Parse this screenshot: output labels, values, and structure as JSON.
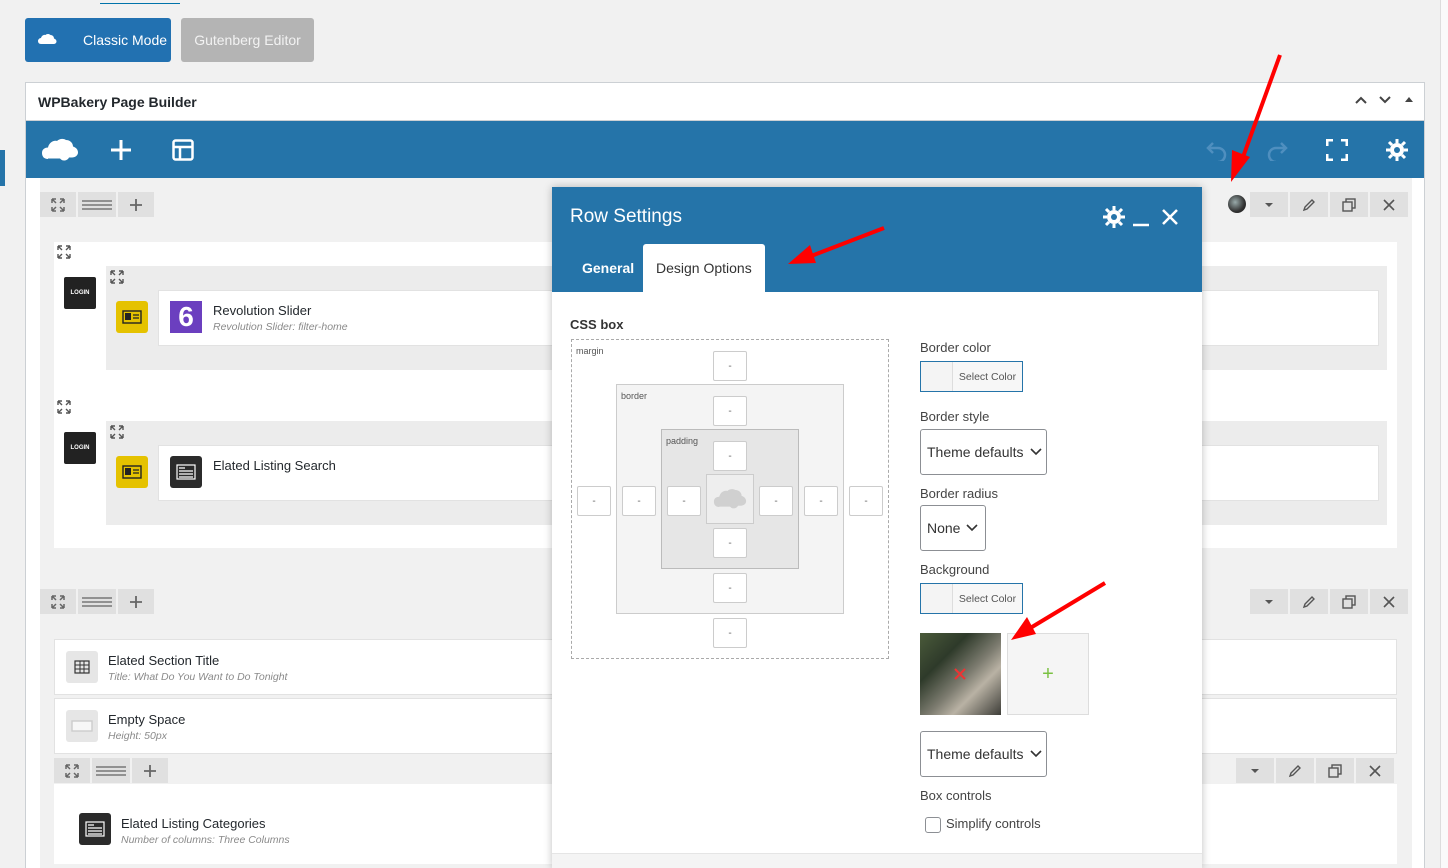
{
  "editor_mode": {
    "classic_label": "Classic Mode",
    "gutenberg_label": "Gutenberg Editor"
  },
  "builder": {
    "title": "WPBakery Page Builder",
    "toolbar_icons": [
      "wpbakery-logo-icon",
      "add-element-icon",
      "templates-icon",
      "undo-icon",
      "redo-icon",
      "fullscreen-icon",
      "settings-gear-icon"
    ]
  },
  "rows": [
    {
      "elements": [
        {
          "title": "Revolution Slider",
          "subtitle": "Revolution Slider: filter-home"
        },
        {
          "title": "Elated Listing Search",
          "subtitle": ""
        }
      ]
    },
    {
      "elements": [
        {
          "title": "Elated Section Title",
          "subtitle": "Title: What Do You Want to Do Tonight"
        },
        {
          "title": "Empty Space",
          "subtitle": "Height: 50px"
        },
        {
          "title": "Elated Listing Categories",
          "subtitle": "Number of columns: Three Columns"
        }
      ]
    }
  ],
  "login_badge": "LOGIN",
  "modal": {
    "title": "Row Settings",
    "tabs": [
      {
        "label": "General",
        "active": false
      },
      {
        "label": "Design Options",
        "active": true
      }
    ],
    "css_box": {
      "label": "CSS box",
      "margin_label": "margin",
      "border_label": "border",
      "padding_label": "padding",
      "placeholder": "-"
    },
    "border_color": {
      "label": "Border color",
      "button": "Select Color"
    },
    "border_style": {
      "label": "Border style",
      "value": "Theme defaults"
    },
    "border_radius": {
      "label": "Border radius",
      "value": "None"
    },
    "background": {
      "label": "Background",
      "button": "Select Color",
      "image_options": "Theme defaults",
      "add_symbol": "+"
    },
    "box_controls": {
      "label": "Box controls",
      "checkbox_label": "Simplify controls",
      "checked": false
    }
  },
  "colors": {
    "toolbar_blue": "#2574a9",
    "annotation_arrow": "#ff0000",
    "classic_button": "#2271b1",
    "element_yellow": "#e5c200"
  }
}
